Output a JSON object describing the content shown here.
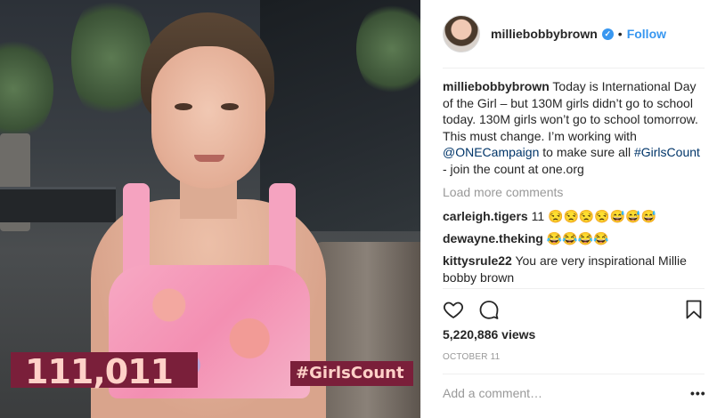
{
  "media": {
    "counter": "111,011",
    "hashtag_overlay": "#GirlsCount"
  },
  "post": {
    "username": "milliebobbybrown",
    "verified_icon": "verified-badge-icon",
    "separator": "•",
    "follow_label": "Follow",
    "caption": {
      "username": "milliebobbybrown",
      "text_1": " Today is International Day of the Girl – but 130M girls didn’t go to school today. 130M girls won’t go to school tomorrow. This must change. I’m working with ",
      "mention": "@ONECampaign",
      "text_2": " to make sure all ",
      "hashtag": "#GirlsCount",
      "text_3": " - join the count at one.org"
    },
    "load_more": "Load more comments",
    "comments": [
      {
        "username": "carleigh.tigers",
        "text": " 11 😒😒😒😒😅😅😅"
      },
      {
        "username": "dewayne.theking",
        "text": " 😂😂😂😂"
      },
      {
        "username": "kittysrule22",
        "text": " You are very inspirational Millie bobby brown"
      }
    ],
    "icons": {
      "like": "heart-icon",
      "comment": "comment-bubble-icon",
      "save": "bookmark-icon"
    },
    "views": "5,220,886 views",
    "date": "OCTOBER 11",
    "add_comment_placeholder": "Add a comment…",
    "more_options": "•••"
  }
}
